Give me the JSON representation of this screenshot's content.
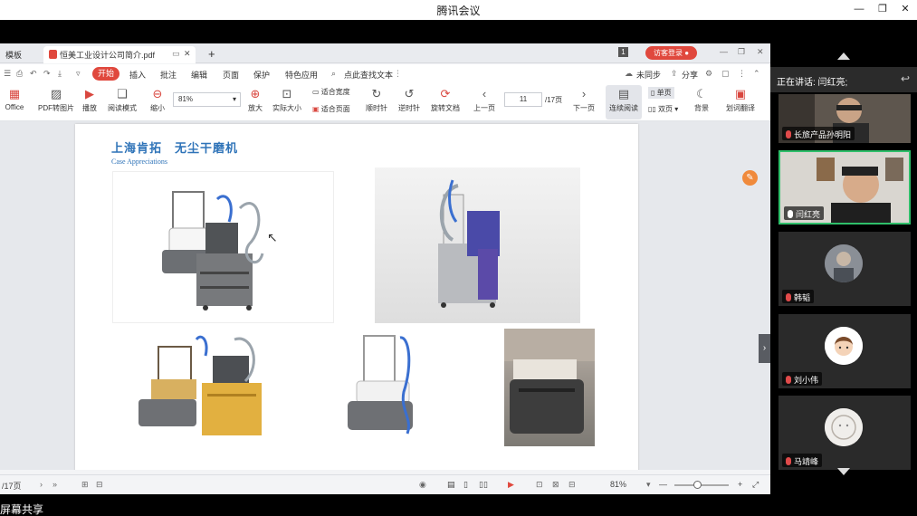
{
  "app": {
    "title": "腾讯会议"
  },
  "wps": {
    "tabs": {
      "template": "模板",
      "document": "恒美工业设计公司简介.pdf",
      "add": "+"
    },
    "login": "访客登录",
    "badge": "1",
    "menu": {
      "start": "开始",
      "insert": "插入",
      "annotate": "批注",
      "edit": "编辑",
      "page": "页面",
      "protect": "保护",
      "features": "特色应用",
      "search": "点此查找文本",
      "sync": "未同步",
      "share": "分享"
    },
    "toolbar": {
      "office": "Office",
      "pdf_to_image": "PDF转图片",
      "play": "播放",
      "read_mode": "阅读模式",
      "zoom_out": "缩小",
      "zoom_value": "81%",
      "zoom_in": "放大",
      "actual_size": "实际大小",
      "fit_width": "适合宽度",
      "fit_page": "适合页面",
      "rotate_cw": "顺时针",
      "rotate_ccw": "逆时针",
      "rotate_doc": "旋转文档",
      "prev_page": "上一页",
      "page_current": "11",
      "page_total": "/17页",
      "next_page": "下一页",
      "continuous": "连续阅读",
      "single": "单页",
      "double": "双页",
      "background": "背景",
      "translate": "划词翻译"
    },
    "document": {
      "title": "上海肯拓　无尘干磨机",
      "subtitle": "Case Appreciations"
    },
    "status": {
      "page_total": "/17页",
      "zoom": "81%"
    }
  },
  "share_label": "屏幕共享",
  "panel": {
    "speaking_label": "正在讲话: 闫红亮;",
    "participants": [
      {
        "name": "长旅产品孙明阳",
        "muted": true
      },
      {
        "name": "闫红亮",
        "muted": false
      },
      {
        "name": "韩韬",
        "muted": true
      },
      {
        "name": "刘小伟",
        "muted": true
      },
      {
        "name": "马靖峰",
        "muted": true
      }
    ]
  },
  "colors": {
    "accent_red": "#e0483d",
    "title_blue": "#2e73b8",
    "active_green": "#2fbf6a"
  }
}
